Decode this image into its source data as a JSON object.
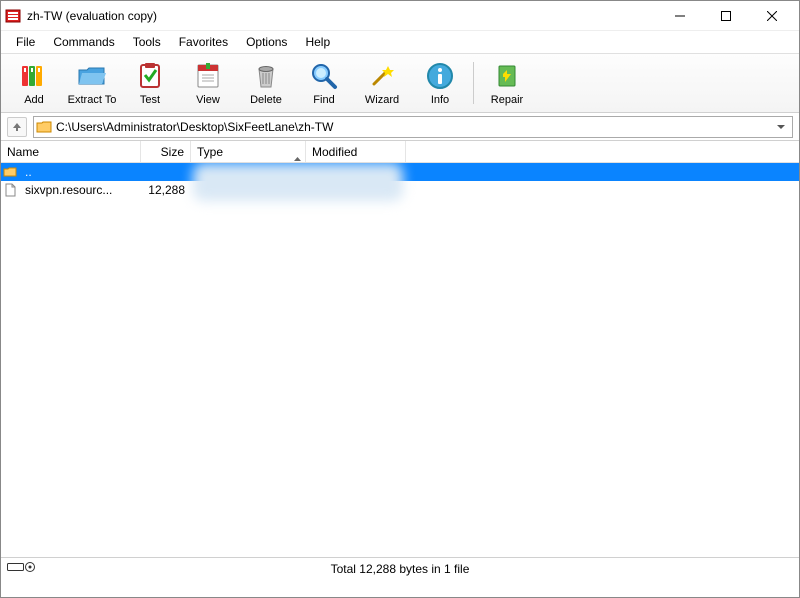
{
  "window": {
    "title": "zh-TW (evaluation copy)"
  },
  "menu": {
    "items": [
      "File",
      "Commands",
      "Tools",
      "Favorites",
      "Options",
      "Help"
    ]
  },
  "toolbar": {
    "add": "Add",
    "extract": "Extract To",
    "test": "Test",
    "view": "View",
    "delete": "Delete",
    "find": "Find",
    "wizard": "Wizard",
    "info": "Info",
    "repair": "Repair"
  },
  "address": {
    "path": "C:\\Users\\Administrator\\Desktop\\SixFeetLane\\zh-TW"
  },
  "columns": {
    "name": "Name",
    "size": "Size",
    "type": "Type",
    "modified": "Modified"
  },
  "rows": {
    "parent": {
      "name": ".."
    },
    "file1": {
      "name": "sixvpn.resourc...",
      "size": "12,288"
    }
  },
  "status": {
    "text": "Total 12,288 bytes in 1 file"
  }
}
